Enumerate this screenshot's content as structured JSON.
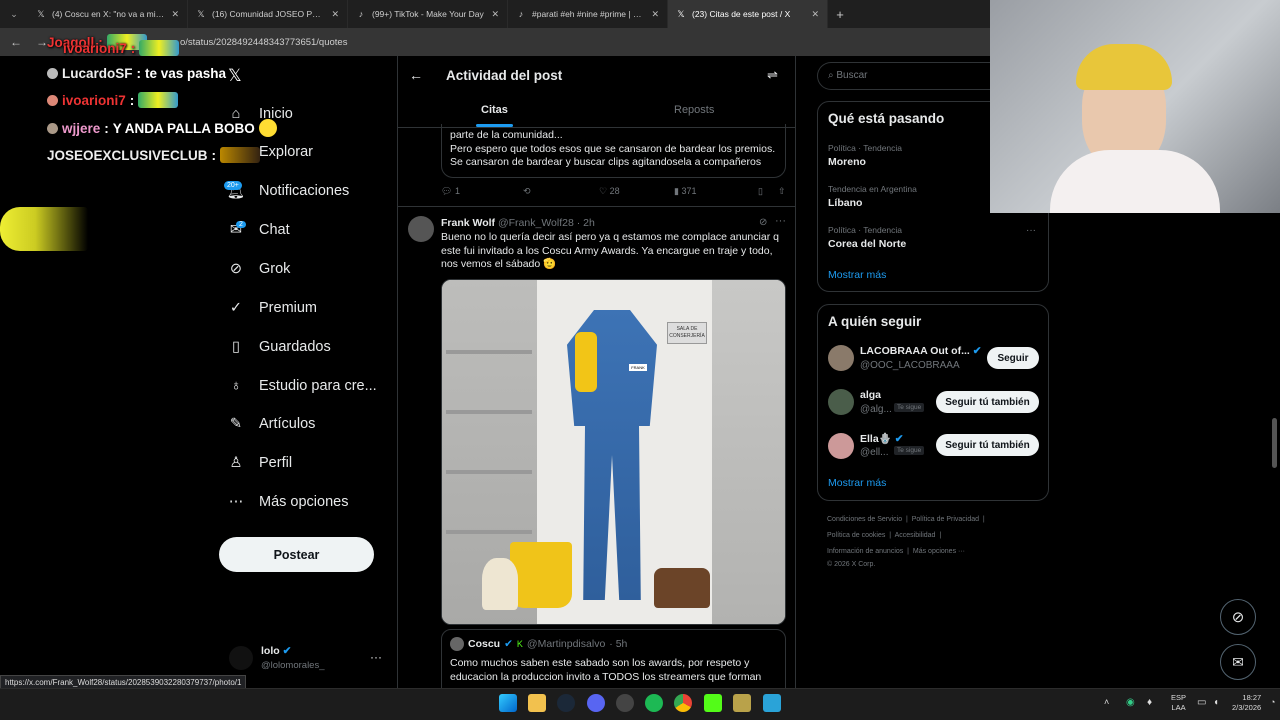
{
  "browser": {
    "tabs": [
      {
        "title": "(4) Coscu en X: \"no va a mirar fijo...",
        "active": false
      },
      {
        "title": "(16) Comunidad JOSEO PRIME",
        "active": false
      },
      {
        "title": "(99+) TikTok - Make Your Day",
        "active": false
      },
      {
        "title": "#parati #eh #nine #prime | mel...",
        "active": false
      },
      {
        "title": "(23) Citas de este post / X",
        "active": true
      }
    ],
    "new_tab": "+",
    "url": "o/status/2028492448343773651/quotes"
  },
  "overlay_chat": [
    {
      "user": "Joaqoll",
      "msg": ""
    },
    {
      "user": "ivoarioni7",
      "msg": ""
    },
    {
      "user": "LucardoSF",
      "msg": "te vas pasha"
    },
    {
      "user": "ivoarioni7",
      "msg": ""
    },
    {
      "user": "wjjere",
      "msg": "Y ANDA PALLA BOBO"
    },
    {
      "user": "JOSEOEXCLUSIVECLUB",
      "msg": ""
    }
  ],
  "nav": {
    "items": [
      {
        "label": "Inicio",
        "icon": "home-icon"
      },
      {
        "label": "Explorar",
        "icon": "search-icon"
      },
      {
        "label": "Notificaciones",
        "icon": "bell-icon",
        "badge": "20+"
      },
      {
        "label": "Chat",
        "icon": "mail-icon",
        "badge": "2"
      },
      {
        "label": "Grok",
        "icon": "grok-icon"
      },
      {
        "label": "Premium",
        "icon": "verified-icon"
      },
      {
        "label": "Guardados",
        "icon": "bookmark-icon"
      },
      {
        "label": "Estudio para cre...",
        "icon": "studio-icon"
      },
      {
        "label": "Artículos",
        "icon": "article-icon"
      },
      {
        "label": "Perfil",
        "icon": "person-icon"
      },
      {
        "label": "Más opciones",
        "icon": "more-circle-icon"
      }
    ],
    "post_button": "Postear",
    "account": {
      "name": "lolo",
      "handle": "@lolomorales_"
    }
  },
  "center": {
    "title": "Actividad del post",
    "tabs": [
      {
        "label": "Citas",
        "active": true
      },
      {
        "label": "Reposts",
        "active": false
      }
    ],
    "prev_tweet": {
      "lines": [
        "parte de la comunidad...",
        "Pero espero que todos esos que se cansaron de bardear los premios.",
        "Se cansaron de bardear y buscar clips agitandosela a compañeros"
      ],
      "replies": "1",
      "likes": "28",
      "views": "371"
    },
    "tweet": {
      "name": "Frank Wolf",
      "handle": "@Frank_Wolf28",
      "time": "· 2h",
      "text": "Bueno no lo quería decir así pero ya q estamos me complace anunciar q este fui invitado a los Coscu Army Awards. Ya encargue en traje y todo, nos vemos el sábado 🫡",
      "image_sign": "SALA DE CONSERJERÍA",
      "image_tag": "FRANK",
      "quoted": {
        "name": "Coscu",
        "handle": "@Martinpdisalvo",
        "time": "· 5h",
        "text": "Como muchos saben este sabado son los awards, por respeto y educacion la produccion invito a TODOS los streamers que forman"
      }
    }
  },
  "right": {
    "search_placeholder": "Buscar",
    "trends_title": "Qué está pasando",
    "trends": [
      {
        "context": "Política · Tendencia",
        "name": "Moreno"
      },
      {
        "context": "Tendencia en Argentina",
        "name": "Líbano"
      },
      {
        "context": "Política · Tendencia",
        "name": "Corea del Norte"
      }
    ],
    "show_more": "Mostrar más",
    "follow_title": "A quién seguir",
    "follow": [
      {
        "name": "LACOBRAAA Out of...",
        "handle": "@OOC_LACOBRAAA",
        "button": "Seguir",
        "follows_you": ""
      },
      {
        "name": "alga",
        "handle": "@alg...",
        "button": "Seguir tú también",
        "follows_you": "Te sigue"
      },
      {
        "name": "Ella🪬",
        "handle": "@ell...",
        "button": "Seguir tú también",
        "follows_you": "Te sigue"
      }
    ],
    "footer": [
      "Condiciones de Servicio",
      "Política de Privacidad",
      "Política de cookies",
      "Accesibilidad",
      "Información de anuncios",
      "Más opciones ···",
      "© 2026 X Corp."
    ]
  },
  "status_url": "https://x.com/Frank_Wolf28/status/2028539032280379737/photo/1",
  "taskbar": {
    "lang1": "ESP",
    "lang2": "LAA",
    "time": "18:27",
    "date": "2/3/2026"
  }
}
